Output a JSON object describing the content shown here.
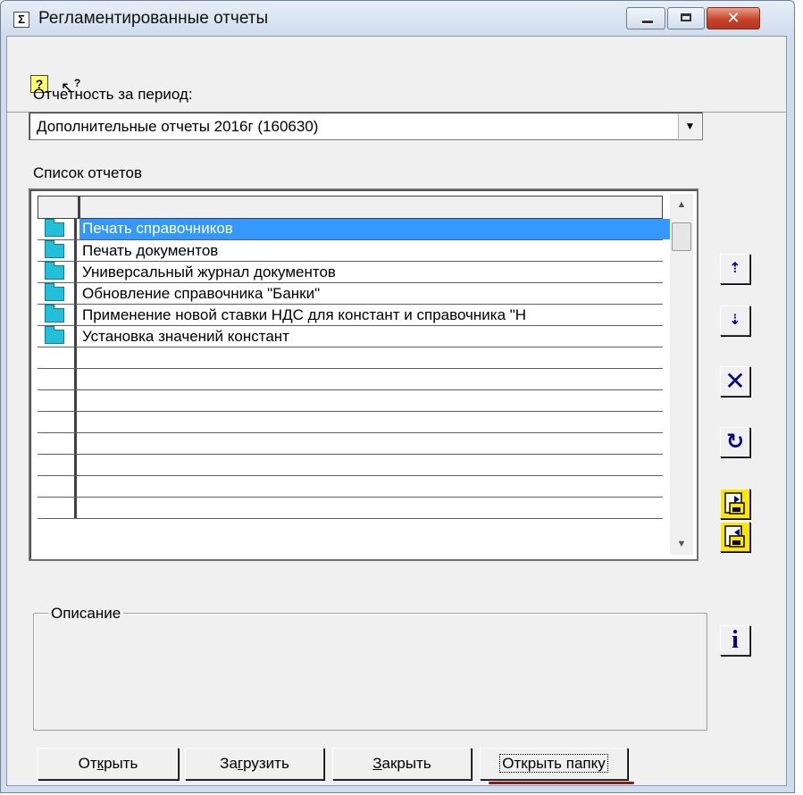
{
  "window": {
    "title": "Регламентированные отчеты",
    "app_icon": "sigma-icon",
    "controls": {
      "minimize": "minimize-icon",
      "maximize": "maximize-icon",
      "close": "✕"
    }
  },
  "toolbar": {
    "help_icon": "?",
    "whatis_icon_arrow": "↖",
    "whatis_icon_q": "?"
  },
  "period": {
    "label": "Отчетность за период:",
    "selected": "Дополнительные отчеты 2016г (160630)",
    "dropdown_arrow": "▼"
  },
  "reports": {
    "label": "Список отчетов",
    "items": [
      {
        "label": "Печать справочников",
        "selected": true
      },
      {
        "label": "Печать документов",
        "selected": false
      },
      {
        "label": "Универсальный журнал документов",
        "selected": false
      },
      {
        "label": "Обновление справочника \"Банки\"",
        "selected": false
      },
      {
        "label": "Применение новой ставки НДС для констант и справочника \"Н",
        "selected": false
      },
      {
        "label": "Установка значений констант",
        "selected": false
      }
    ],
    "empty_rows": 8,
    "scroll_up": "▲",
    "scroll_down": "▼"
  },
  "side_buttons": {
    "move_up": "⇡",
    "move_down": "⇣",
    "delete": "✕",
    "refresh": "↻",
    "info": "i"
  },
  "description": {
    "label": "Описание"
  },
  "buttons": {
    "open_pre": "От",
    "open_u": "к",
    "open_post": "рыть",
    "load_pre": "За",
    "load_u": "г",
    "load_post": "рузить",
    "close_u": "З",
    "close_post": "акрыть",
    "open_folder": "Открыть папку"
  },
  "colors": {
    "selection": "#3399ff",
    "folder_icon": "#22c0d8",
    "highlight_underline": "#8b1a1a"
  }
}
